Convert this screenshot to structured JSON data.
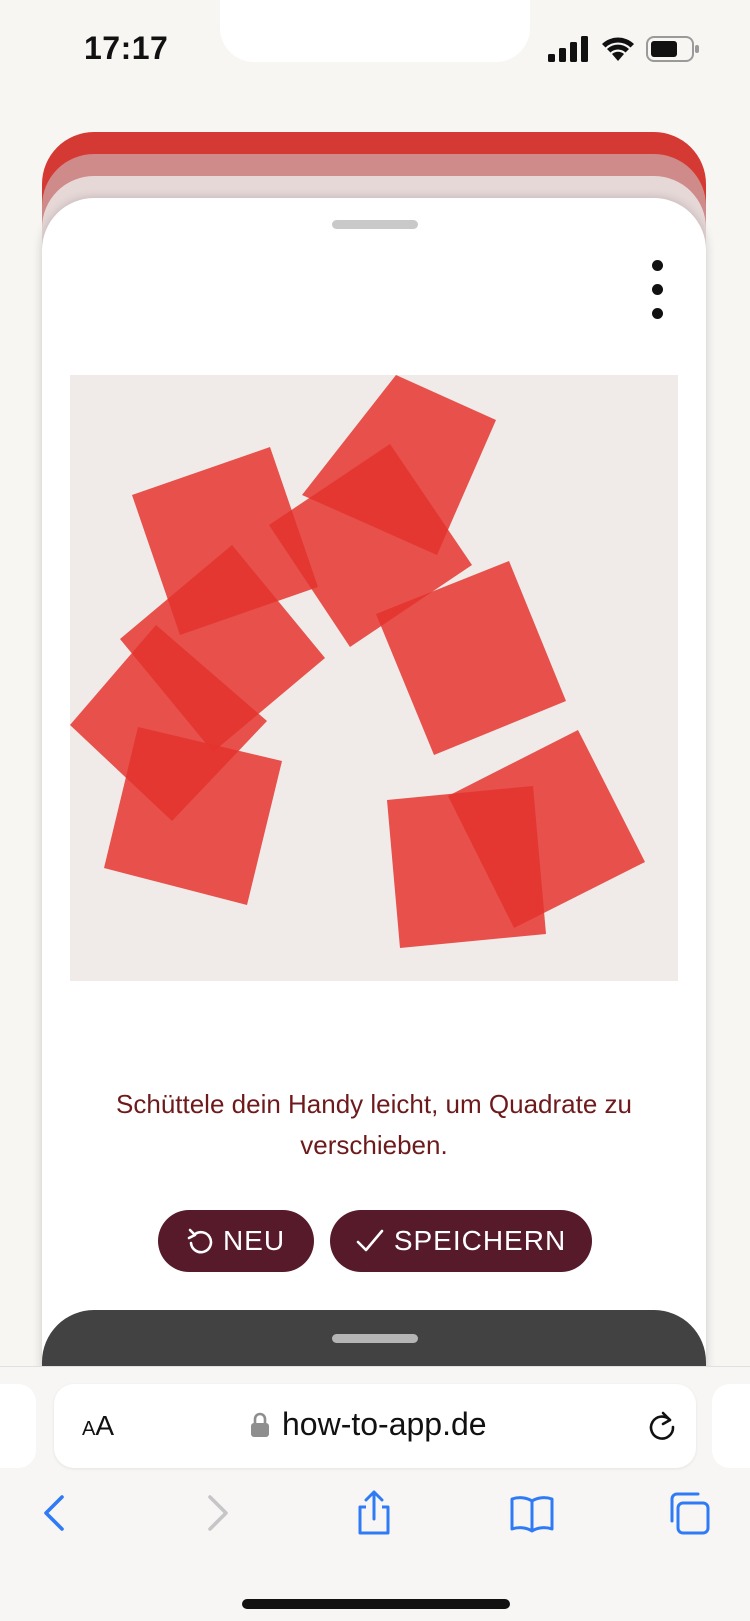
{
  "status_bar": {
    "time": "17:17"
  },
  "sheet": {
    "instruction": "Schüttele dein Handy leicht, um Quadrate zu verschieben.",
    "buttons": {
      "new_label": "NEU",
      "save_label": "SPEICHERN"
    }
  },
  "artwork": {
    "square_color": "#e5322c",
    "background_color": "#f0ebe8",
    "square_count": 9
  },
  "browser": {
    "text_size_label": "AA",
    "url": "how-to-app.de",
    "toolbar": [
      "back-icon",
      "forward-icon",
      "share-icon",
      "bookmarks-icon",
      "tabs-icon"
    ]
  },
  "colors": {
    "accent": "#571a2b",
    "text_red": "#6d1a1c",
    "link_blue": "#2f7bf6"
  }
}
